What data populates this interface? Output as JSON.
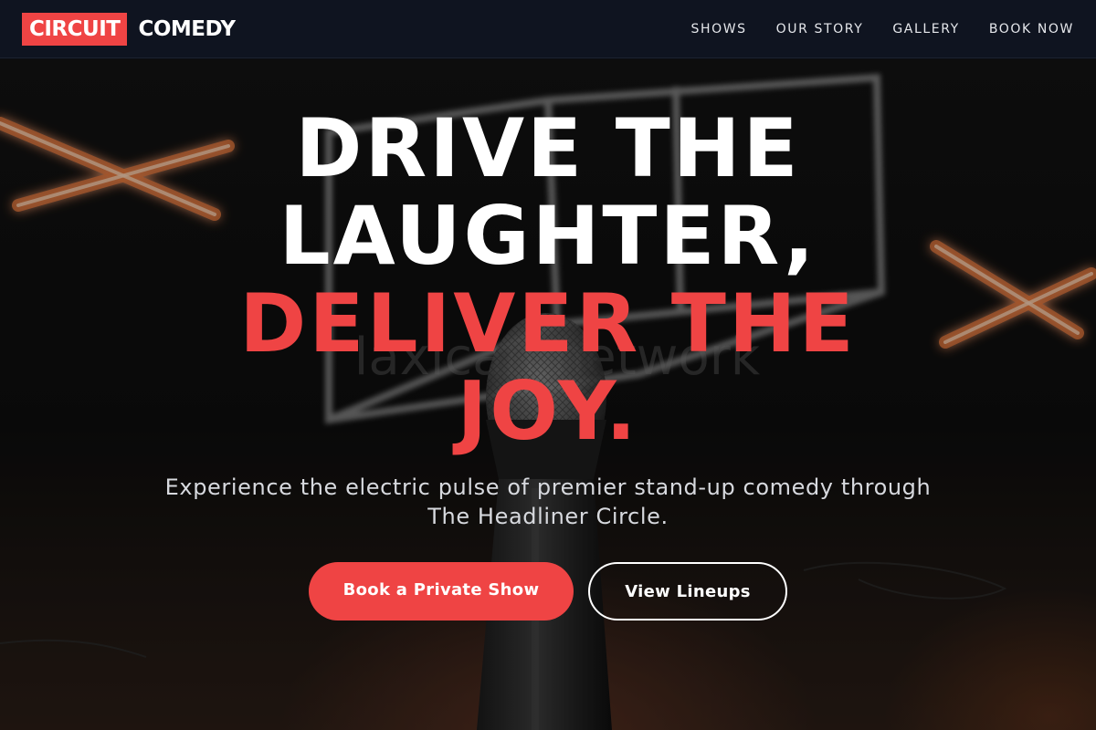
{
  "brand": {
    "badge": "CIRCUIT",
    "name": "COMEDY",
    "accent_color": "#ef4444"
  },
  "nav": {
    "items": [
      {
        "label": "SHOWS"
      },
      {
        "label": "OUR STORY"
      },
      {
        "label": "GALLERY"
      },
      {
        "label": "BOOK NOW"
      }
    ]
  },
  "hero": {
    "headline_line1": "DRIVE THE",
    "headline_line2": "LAUGHTER,",
    "headline_accent_line1": "DELIVER THE",
    "headline_accent_line2": "JOY.",
    "subtitle": "Experience the electric pulse of premier stand-up comedy through The Headliner Circle.",
    "primary_cta": "Book a Private Show",
    "secondary_cta": "View Lineups",
    "background_image": "microphone-on-stage-with-neon-lights"
  }
}
